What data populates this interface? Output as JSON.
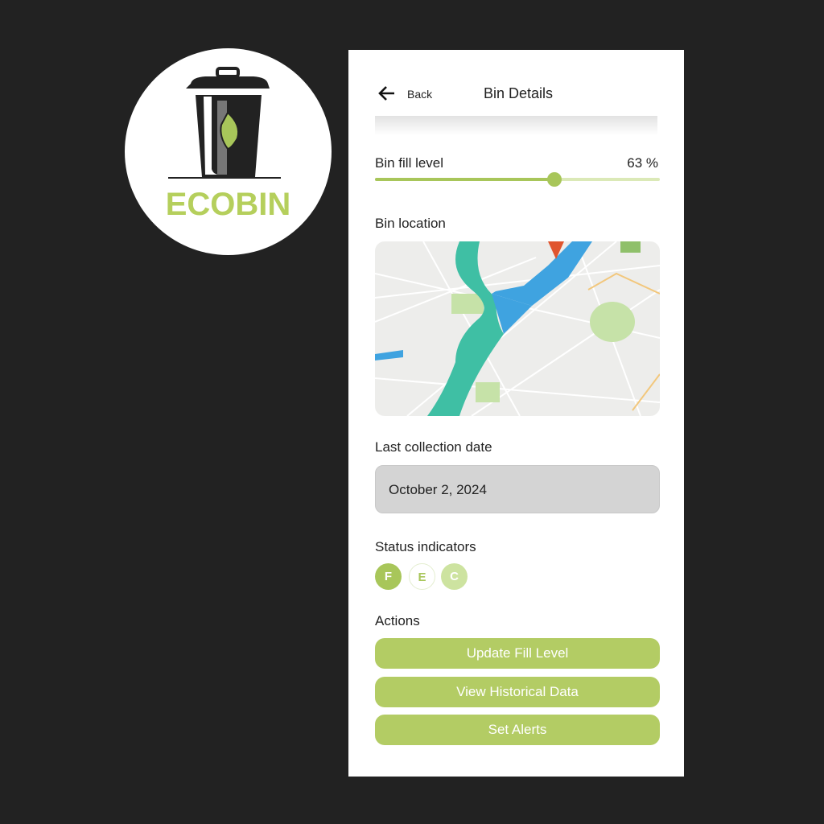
{
  "logo": {
    "text": "ECOBIN"
  },
  "header": {
    "back_label": "Back",
    "title": "Bin Details"
  },
  "fill": {
    "label": "Bin fill level",
    "value_text": "63 %",
    "value": 63
  },
  "location": {
    "label": "Bin location"
  },
  "collection": {
    "label": "Last collection date",
    "value": "October 2, 2024"
  },
  "status": {
    "label": "Status indicators",
    "items": [
      {
        "letter": "F",
        "color": "#a8c65a"
      },
      {
        "letter": "E",
        "color": "#ffffff"
      },
      {
        "letter": "C",
        "color": "#cde3a0"
      }
    ]
  },
  "actions": {
    "label": "Actions",
    "buttons": [
      "Update Fill Level",
      "View Historical Data",
      "Set Alerts"
    ]
  },
  "colors": {
    "accent": "#b3cc64",
    "background": "#222222"
  }
}
